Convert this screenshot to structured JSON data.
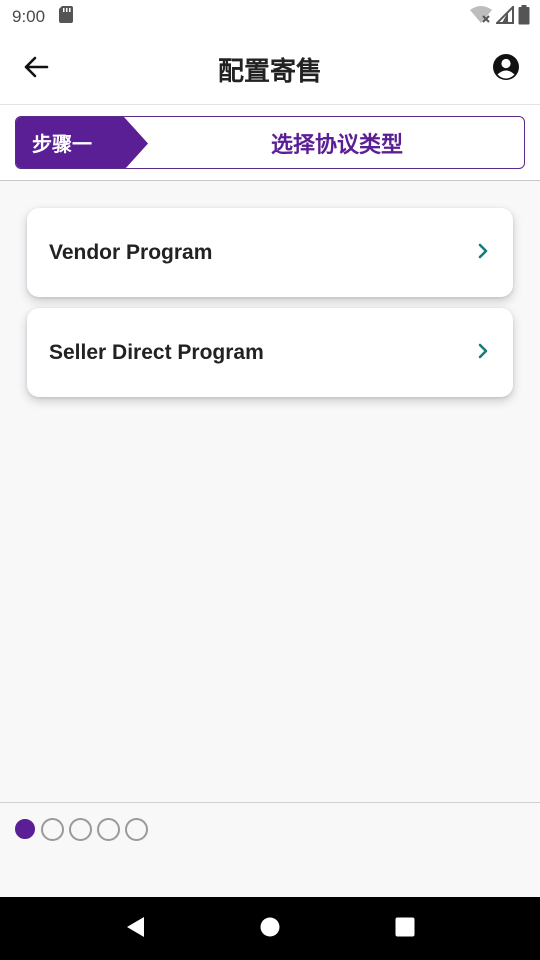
{
  "status_bar": {
    "time": "9:00",
    "icons": [
      "sd-card-icon",
      "wifi-off-icon",
      "signal-icon",
      "battery-icon"
    ]
  },
  "header": {
    "title": "配置寄售",
    "back_icon": "arrow-left-icon",
    "account_icon": "account-circle-icon"
  },
  "step": {
    "badge_label": "步骤一",
    "description": "选择协议类型"
  },
  "programs": [
    {
      "label": "Vendor Program",
      "icon": "chevron-right-icon"
    },
    {
      "label": "Seller Direct Program",
      "icon": "chevron-right-icon"
    }
  ],
  "pager": {
    "total": 5,
    "current": 1
  },
  "nav": {
    "back": "nav-back-icon",
    "home": "nav-home-icon",
    "recents": "nav-recents-icon"
  },
  "colors": {
    "accent": "#5a1e95",
    "chevron": "#1a7a80"
  }
}
